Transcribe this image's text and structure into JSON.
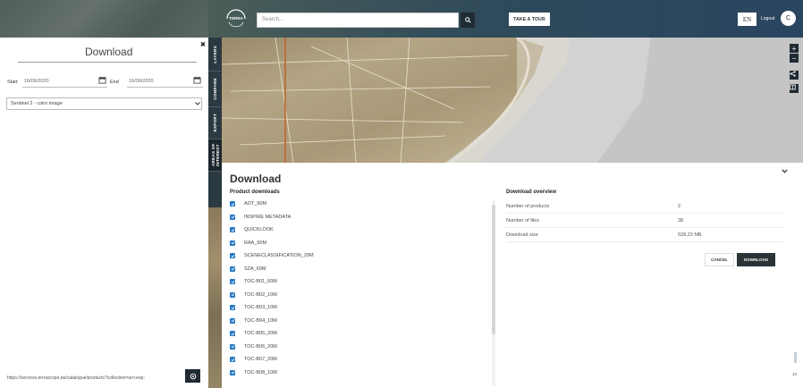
{
  "header": {
    "logo_text": "TERRA",
    "search_placeholder": "Search...",
    "tour_label": "TAKE A TOUR",
    "language": "EN",
    "logout_label": "Logout",
    "avatar_initial": "C"
  },
  "left_panel": {
    "title": "Download",
    "start_label": "Start",
    "start_value": "16/06/2020",
    "end_label": "End",
    "end_value": "16/06/2020",
    "product_selected": "Sentinel 2 - color image",
    "url": "https://services.terrascope.be/catalogue/products?collection=urn:eop:"
  },
  "tabs": [
    {
      "label": "LAYERS"
    },
    {
      "label": "COMPARE"
    },
    {
      "label": "EXPORT"
    },
    {
      "label": "AREAS OF INTEREST"
    }
  ],
  "download": {
    "title": "Download",
    "products_title": "Product downloads",
    "overview_title": "Download overview",
    "products": [
      "AOT_60M",
      "INSPIRE METADATA",
      "QUICKLOOK",
      "RAA_60M",
      "SCENECLASSIFICATION_20M",
      "SZA_60M",
      "TOC-B01_60M",
      "TOC-B02_10M",
      "TOC-B03_10M",
      "TOC-B04_10M",
      "TOC-B05_20M",
      "TOC-B06_20M",
      "TOC-B07_20M",
      "TOC-B08_10M"
    ],
    "overview": [
      {
        "label": "Number of products",
        "value": "2"
      },
      {
        "label": "Number of files",
        "value": "38"
      },
      {
        "label": "Download size",
        "value": "528.23 MB"
      }
    ],
    "cancel_label": "CANCEL",
    "download_label": "DOWNLOAD"
  },
  "map_controls": {
    "zoom_in": "+",
    "zoom_out": "−"
  },
  "corner_number": "10"
}
